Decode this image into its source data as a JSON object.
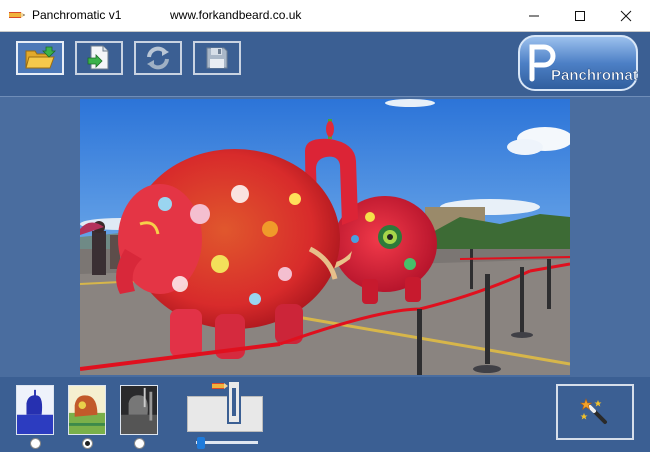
{
  "window": {
    "title": "Panchromatic v1",
    "url": "www.forkandbeard.co.uk",
    "controls": {
      "minimize": "minimize-icon",
      "maximize": "maximize-icon",
      "close": "close-icon"
    }
  },
  "toolbar": {
    "buttons": [
      {
        "name": "open-folder-button",
        "icon": "folder-open-icon",
        "active": true
      },
      {
        "name": "export-button",
        "icon": "export-file-icon",
        "active": false
      },
      {
        "name": "refresh-button",
        "icon": "refresh-icon",
        "active": false
      },
      {
        "name": "save-button",
        "icon": "floppy-disk-icon",
        "active": false
      }
    ],
    "logo_text": "Panchromatic"
  },
  "viewer": {
    "image": "photo-of-painted-elephant-sculptures"
  },
  "bottom": {
    "thumbnails": [
      {
        "name": "thumbnail-blue-tint",
        "selected": false
      },
      {
        "name": "thumbnail-heatmap-tint",
        "selected": true
      },
      {
        "name": "thumbnail-dark-tint",
        "selected": false
      }
    ],
    "slider": {
      "value": 0.03
    },
    "magic_button_icon": "magic-wand-icon"
  },
  "colors": {
    "panel": "#3b5f93",
    "viewer_bg": "#4a6d9f",
    "accent": "#4d79b8"
  }
}
